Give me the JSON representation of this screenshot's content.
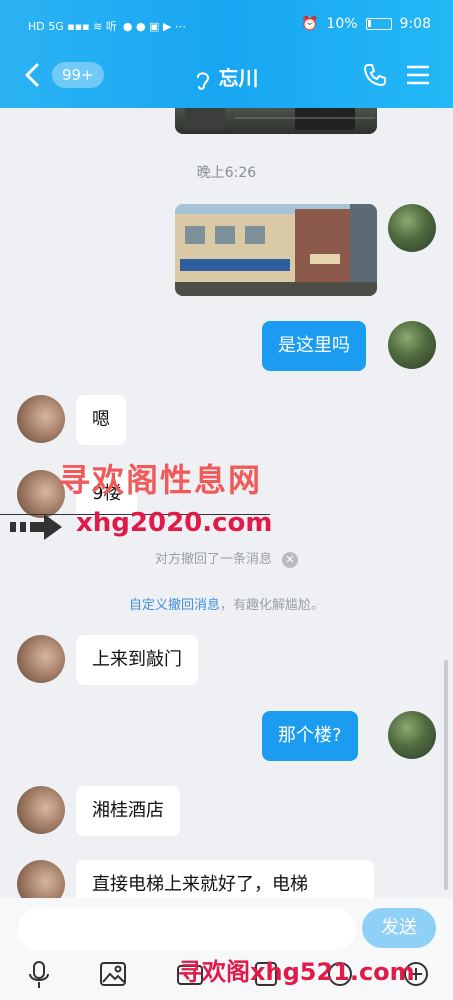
{
  "status": {
    "left_icons": "HD 5G ▪▪▪ ≋ 听",
    "battery_percent": "10%",
    "time": "9:08"
  },
  "nav": {
    "unread_badge": "99+",
    "contact_name": "忘川"
  },
  "messages": {
    "time_1": "晚上6:26",
    "self_1": "是这里吗",
    "other_1": "嗯",
    "other_2": "9楼",
    "recall_notice": "对方撤回了一条消息",
    "recall_tip_link": "自定义撤回消息",
    "recall_tip_rest": "，有趣化解尴尬。",
    "other_3": "上来到敲门",
    "self_2": "那个楼?",
    "other_4": "湘桂酒店",
    "other_5": "直接电梯上来就好了，电梯"
  },
  "watermarks": {
    "cn": "寻欢阁性息网",
    "url1": "xhg2020.com",
    "url2": "寻欢阁xhg521.com"
  },
  "input": {
    "send_label": "发送"
  },
  "colors": {
    "header": "#18a6f2",
    "self_bubble": "#1b9cf0",
    "send_button": "#8fd0f7"
  }
}
